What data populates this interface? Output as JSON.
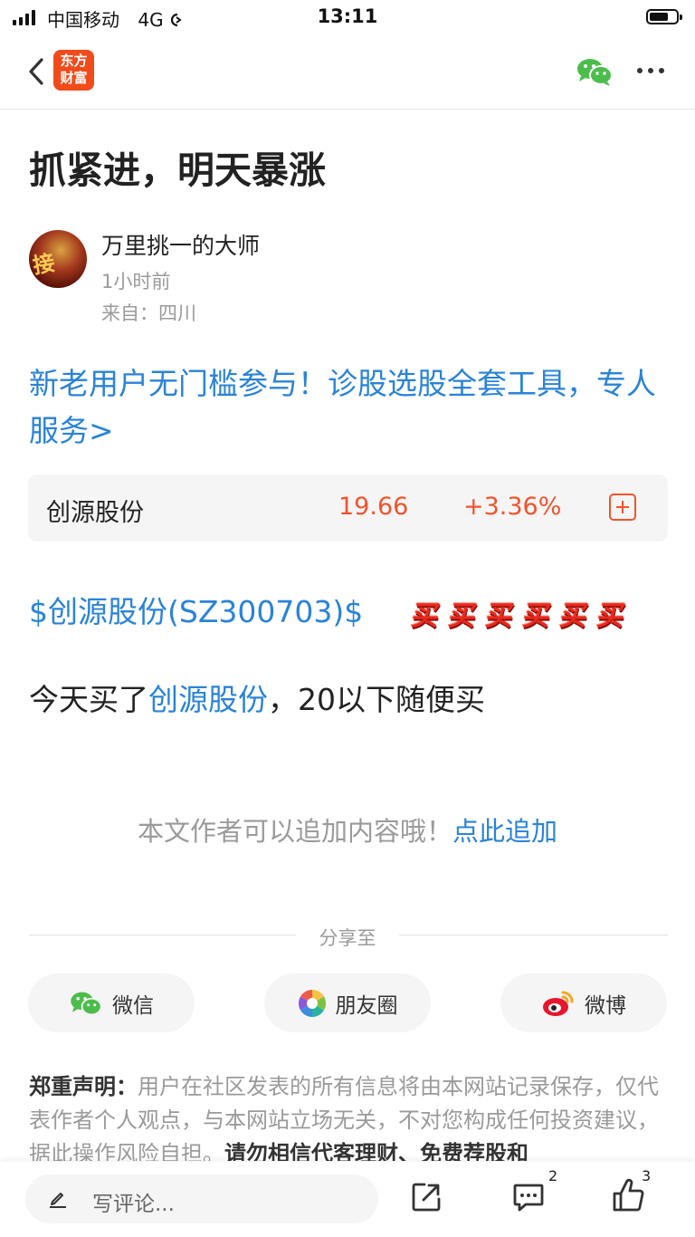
{
  "status_bar": {
    "carrier": "中国移动",
    "network": "4G",
    "time": "13:11"
  },
  "nav": {
    "logo_line1": "东方",
    "logo_line2": "财富",
    "brand_color": "#f24b1b"
  },
  "post": {
    "title": "抓紧进，明天暴涨",
    "author": "万里挑一的大师",
    "time_ago": "1小时前",
    "location": "来自：四川",
    "promo": "新老用户无门槛参与！诊股选股全套工具，专人服务>"
  },
  "quote": {
    "name": "创源股份",
    "price": "19.66",
    "change": "+3.36%",
    "up_color": "#f0542d"
  },
  "content": {
    "stock_tag": "$创源股份(SZ300703)$",
    "buy_words": [
      "买",
      "买",
      "买",
      "买",
      "买",
      "买"
    ],
    "line_prefix": "今天买了",
    "line_link": "创源股份",
    "line_suffix": "，20以下随便买",
    "link_color": "#2a83d8"
  },
  "append": {
    "text": "本文作者可以追加内容哦！",
    "link": "点此追加"
  },
  "share": {
    "label": "分享至",
    "wechat": "微信",
    "moments": "朋友圈",
    "weibo": "微博"
  },
  "disclaimer": {
    "title": "郑重声明：",
    "text": "用户在社区发表的所有信息将由本网站记录保存，仅代表作者个人观点，与本网站立场无关，不对您构成任何投资建议，据此操作风险自担。",
    "strong": "请勿相信代客理财、免费荐股和"
  },
  "bottom_bar": {
    "comment_placeholder": "写评论...",
    "comment_count": "2",
    "like_count": "3"
  },
  "icons": [
    "back-arrow-icon",
    "wechat-icon",
    "more-icon",
    "plus-icon",
    "moments-icon",
    "weibo-icon",
    "pencil-icon",
    "share-out-icon",
    "comment-icon",
    "thumbs-up-icon"
  ]
}
